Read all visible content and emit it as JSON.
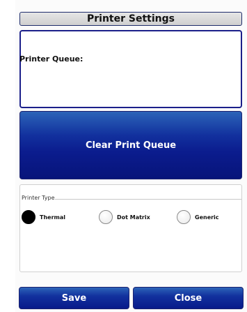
{
  "header": {
    "title": "Printer Settings"
  },
  "queue": {
    "label": "Printer Queue:"
  },
  "clear_button": {
    "label": "Clear Print Queue"
  },
  "printer_type": {
    "legend": "Printer Type",
    "options": [
      {
        "label": "Thermal",
        "selected": true
      },
      {
        "label": "Dot Matrix",
        "selected": false
      },
      {
        "label": "Generic",
        "selected": false
      }
    ]
  },
  "footer": {
    "save_label": "Save",
    "close_label": "Close"
  },
  "colors": {
    "accent": "#0b1c8e",
    "border": "#1b1f8a"
  }
}
